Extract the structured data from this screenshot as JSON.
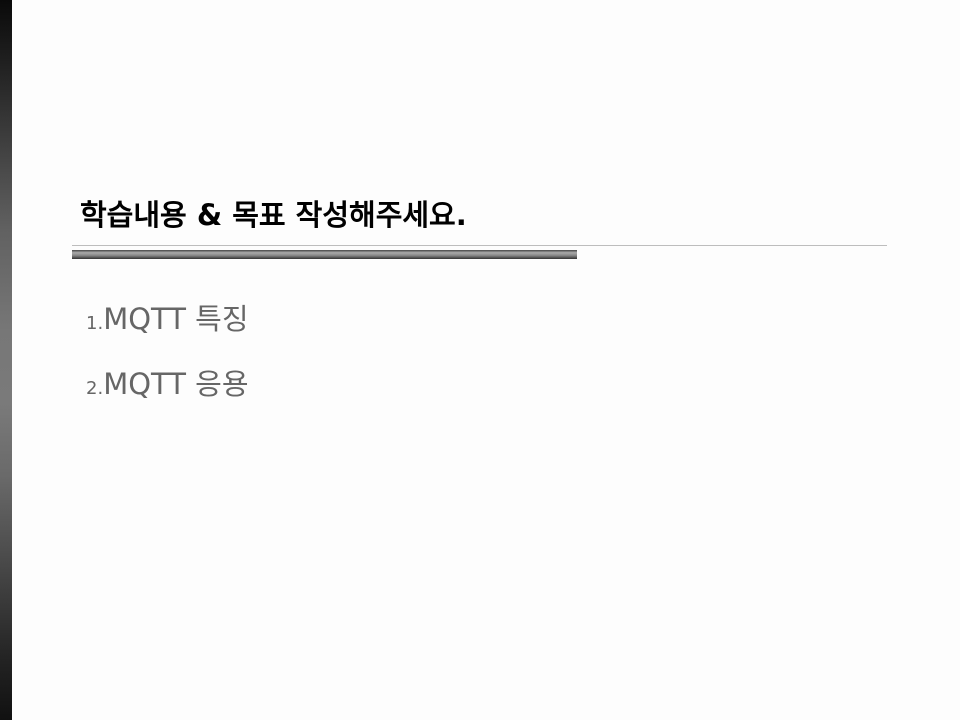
{
  "slide": {
    "title": "학습내용 & 목표 작성해주세요.",
    "items": [
      {
        "number": "1.",
        "text": "MQTT 특징"
      },
      {
        "number": "2.",
        "text": "MQTT 응용"
      }
    ]
  }
}
